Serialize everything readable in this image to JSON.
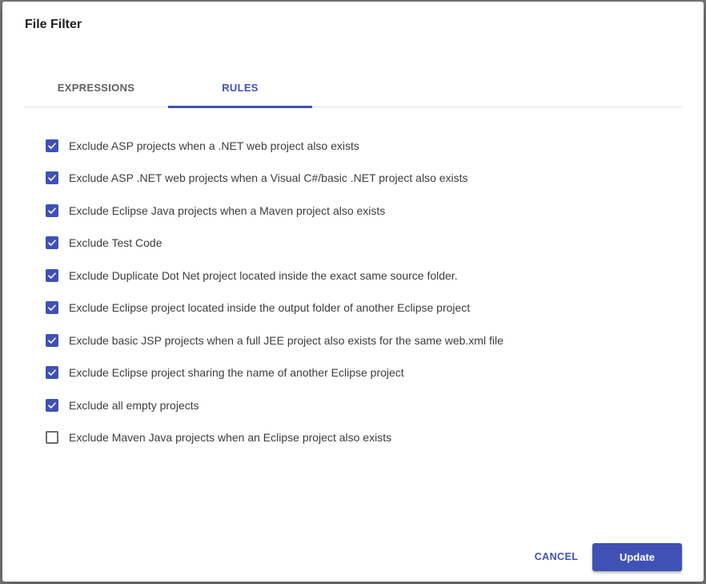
{
  "dialog": {
    "title": "File Filter",
    "accent_color": "#3f51b5"
  },
  "tabs": [
    {
      "label": "EXPRESSIONS",
      "active": false
    },
    {
      "label": "RULES",
      "active": true
    }
  ],
  "rules": [
    {
      "label": "Exclude ASP projects when a .NET web project also exists",
      "checked": true
    },
    {
      "label": "Exclude ASP .NET web projects when a Visual C#/basic .NET project also exists",
      "checked": true
    },
    {
      "label": "Exclude Eclipse Java projects when a Maven project also exists",
      "checked": true
    },
    {
      "label": "Exclude Test Code",
      "checked": true
    },
    {
      "label": "Exclude Duplicate Dot Net project located inside the exact same source folder.",
      "checked": true
    },
    {
      "label": "Exclude Eclipse project located inside the output folder of another Eclipse project",
      "checked": true
    },
    {
      "label": "Exclude basic JSP projects when a full JEE project also exists for the same web.xml file",
      "checked": true
    },
    {
      "label": "Exclude Eclipse project sharing the name of another Eclipse project",
      "checked": true
    },
    {
      "label": "Exclude all empty projects",
      "checked": true
    },
    {
      "label": "Exclude Maven Java projects when an Eclipse project also exists",
      "checked": false
    }
  ],
  "actions": {
    "cancel_label": "CANCEL",
    "update_label": "Update"
  }
}
